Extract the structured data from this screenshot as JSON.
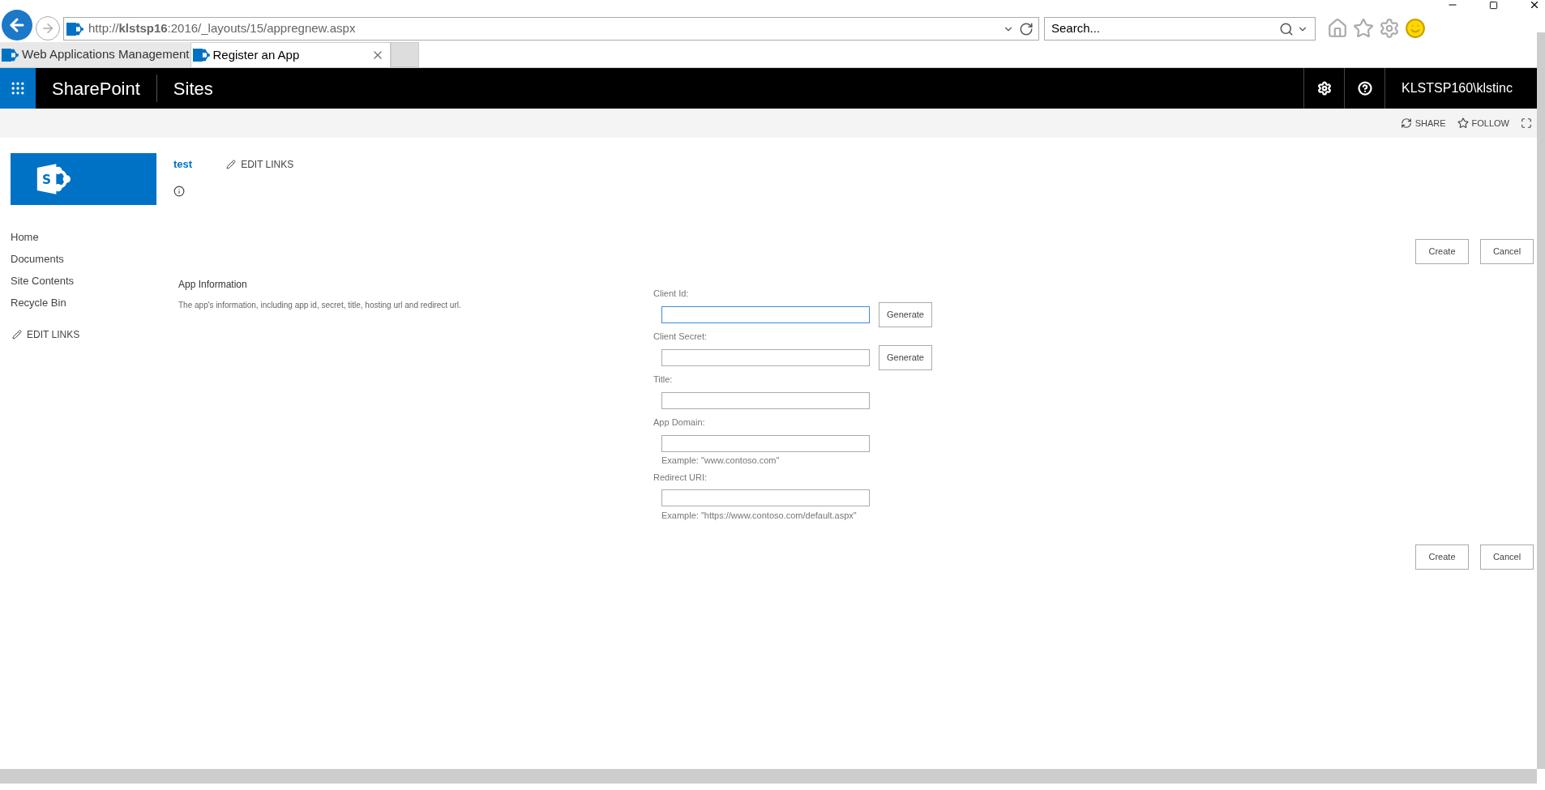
{
  "browser": {
    "url": "http://**klstsp16**:2016/_layouts/15/appregnew.aspx",
    "search": {
      "placeholder": "Search..."
    }
  },
  "tabs": [
    {
      "label": "Web Applications Management",
      "selected": false
    },
    {
      "label": "Register an App",
      "selected": true
    }
  ],
  "suite_bar": {
    "brand": "SharePoint",
    "link": "Sites",
    "user": "KLSTSP160\\klstinc"
  },
  "actions": [
    {
      "label": "SHARE"
    },
    {
      "label": "FOLLOW"
    }
  ],
  "site": {
    "logo_letter": "S",
    "title": "test",
    "edit_links": "EDIT LINKS"
  },
  "nav": {
    "items": [
      "Home",
      "Documents",
      "Site Contents",
      "Recycle Bin"
    ],
    "edit_links": "EDIT LINKS"
  },
  "section": {
    "title": "App Information",
    "description": "The app's information, including app id, secret, title, hosting url and redirect url."
  },
  "fields": [
    {
      "label": "Client Id:",
      "focused": true,
      "button": "Generate"
    },
    {
      "label": "Client Secret:",
      "focused": false,
      "button": "Generate"
    },
    {
      "label": "Title:",
      "focused": false
    },
    {
      "label": "App Domain:",
      "focused": false,
      "hint": "Example: \"www.contoso.com\""
    },
    {
      "label": "Redirect URI:",
      "focused": false,
      "hint": "Example: \"https://www.contoso.com/default.aspx\""
    }
  ],
  "buttons_top": [
    "Create",
    "Cancel"
  ],
  "buttons_bottom": [
    "Create",
    "Cancel"
  ]
}
